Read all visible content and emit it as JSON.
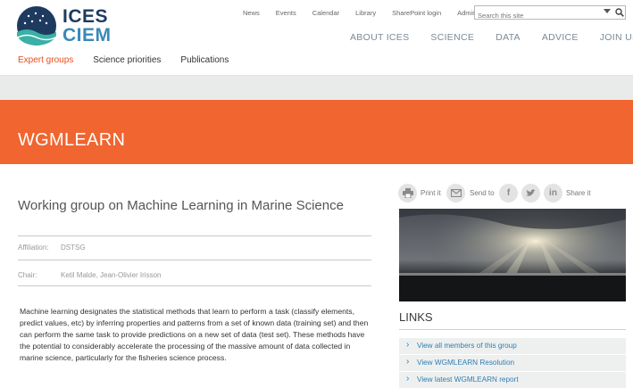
{
  "header": {
    "logo": {
      "top": "ICES",
      "bottom": "CIEM"
    },
    "utility_nav": [
      "News",
      "Events",
      "Calendar",
      "Library",
      "SharePoint login",
      "Admin"
    ],
    "search": {
      "placeholder": "Search this site",
      "value": ""
    },
    "main_nav": [
      "ABOUT ICES",
      "SCIENCE",
      "DATA",
      "ADVICE",
      "JOIN US"
    ]
  },
  "sub_nav": {
    "items": [
      "Expert groups",
      "Science priorities",
      "Publications"
    ],
    "active": "Expert groups"
  },
  "banner": {
    "title": "WGMLEARN"
  },
  "group": {
    "title": "Working group on Machine Learning in Marine Science",
    "affiliation_label": "Affiliation:",
    "affiliation_value": "DSTSG",
    "chair_label": "Chair:",
    "chair_value": "Ketil Malde, Jean-Olivier Irisson",
    "description": "Machine learning designates the statistical methods that learn to perform a task (classify elements, predict values, etc) by inferring properties and patterns from a set of known data (training set) and then can perform the same task to provide predictions on a new set of data (test set). These methods have the potential to considerably accelerate the processing of the massive amount of data collected in marine science, particularly for the fisheries science process."
  },
  "share": {
    "print_label": "Print it",
    "send_label": "Send to",
    "share_label": "Share it",
    "icons": [
      "printer-icon",
      "email-icon",
      "facebook-icon",
      "twitter-icon",
      "linkedin-icon"
    ]
  },
  "links": {
    "title": "LINKS",
    "items": [
      "View all members of this group",
      "View WGMLEARN Resolution",
      "View latest WGMLEARN report"
    ]
  },
  "colors": {
    "accent": "#f06530",
    "link": "#2f7fb1",
    "active_nav": "#e84e1b",
    "logo_dark": "#1f3a5f",
    "logo_light": "#3a89b8"
  }
}
